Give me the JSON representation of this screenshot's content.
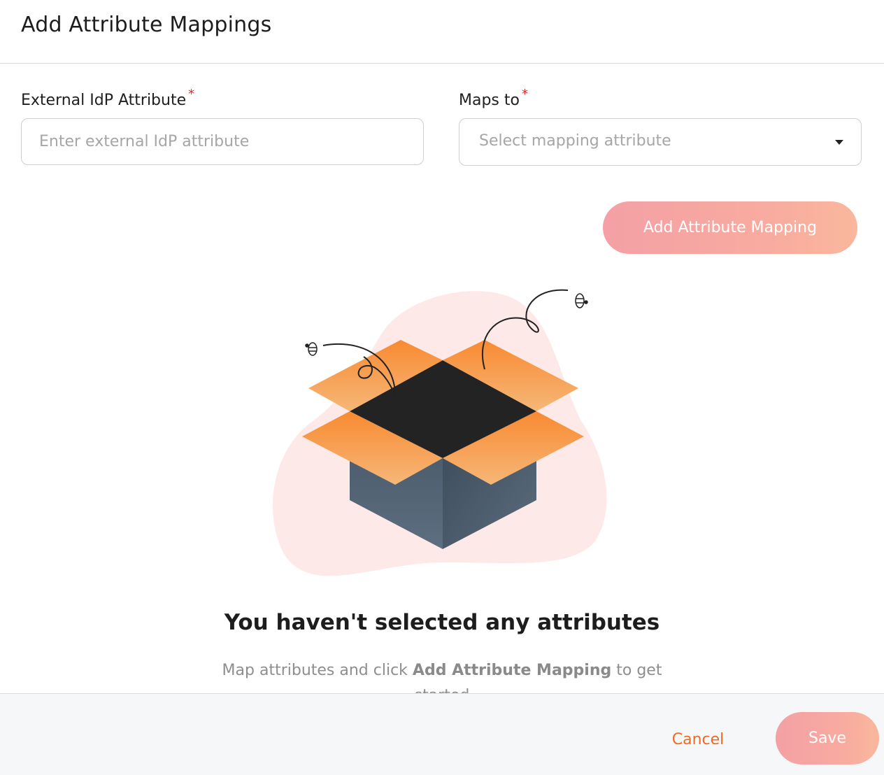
{
  "dialog": {
    "title": "Add Attribute Mappings"
  },
  "form": {
    "external_label": "External IdP Attribute",
    "external_placeholder": "Enter external IdP attribute",
    "external_value": "",
    "maps_to_label": "Maps to",
    "maps_to_placeholder": "Select mapping attribute",
    "required_marker": "*",
    "add_button_label": "Add Attribute Mapping"
  },
  "empty_state": {
    "illustration_icon": "open-box-with-bees-illustration",
    "title": "You haven't selected any attributes",
    "desc_prefix": "Map attributes and click ",
    "desc_bold": "Add Attribute Mapping",
    "desc_suffix": " to get started"
  },
  "footer": {
    "cancel_label": "Cancel",
    "save_label": "Save"
  },
  "colors": {
    "accent": "#f26a21",
    "button_gradient_start": "#f4a0a5",
    "button_gradient_end": "#f9b79d",
    "required": "#e5262b"
  }
}
